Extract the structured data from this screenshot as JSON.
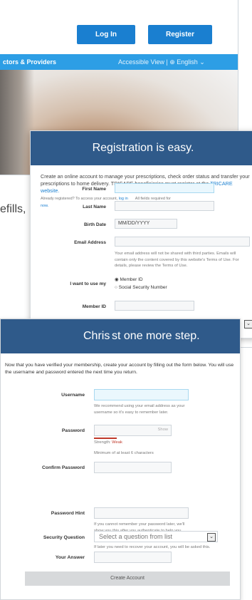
{
  "site": {
    "login_label": "Log In",
    "register_label": "Register",
    "nav_left": "ctors & Providers",
    "nav_right": "Accessible View  |  ⊕ English ⌄"
  },
  "cut_text": "efills,",
  "registration": {
    "title": "Registration is easy.",
    "intro": "Create an online account to manage your prescriptions, check order status and transfer your prescriptions to home delivery. TRICARE beneficiaries must register at the",
    "intro_link": "TRICARE website.",
    "already": "Already registered? To access your account,",
    "already_link": "log in now.",
    "required": "All fields required for registration",
    "first_name_label": "First Name",
    "last_name_label": "Last Name",
    "birth_date_label": "Birth Date",
    "birth_date_placeholder": "MM/DD/YYYY",
    "email_label": "Email Address",
    "email_helper": "Your email address will not be shared with third parties. Emails will contain only the content covered by this website's Terms of Use. For details, please review the Terms of Use.",
    "use_label": "I want to use my",
    "option_member": "Member ID",
    "option_ssn": "Social Security Number",
    "member_id_label": "Member ID"
  },
  "step": {
    "title_part1": "Chris",
    "title_part2": "st one more step.",
    "intro": "Now that you have verified your membership, create your account by filling out the form below. You will use the username and password entered the next time you return.",
    "username_label": "Username",
    "username_helper": "We recommend using your email address as your username so it's easy to remember later.",
    "password_label": "Password",
    "show_label": "Show",
    "strength_prefix": "Strength:",
    "strength_value": "Weak",
    "password_helper": "Minimum of at least 6 characters",
    "confirm_label": "Confirm Password",
    "hint_label": "Password Hint",
    "hint_helper": "If you cannot remember your password later, we'll show you this after you authenticate to help you remember.",
    "security_label": "Security Question",
    "security_placeholder": "Select a question from list",
    "security_helper": "If later you need to recover your account, you will be asked this.",
    "answer_label": "Your Answer",
    "create_label": "Create Account"
  }
}
